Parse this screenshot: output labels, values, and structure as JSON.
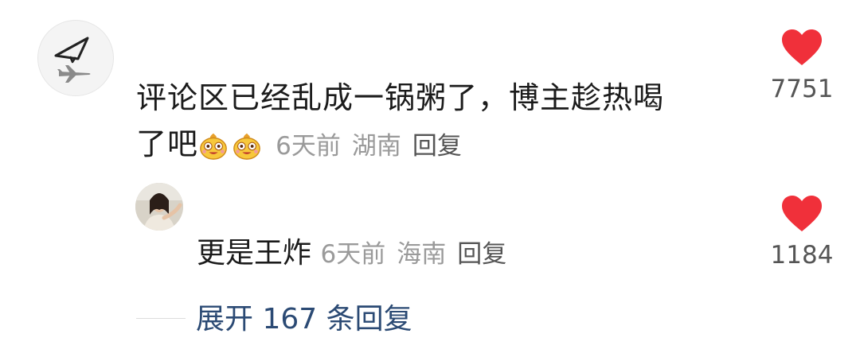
{
  "comment": {
    "text_line1": "评论区已经乱成一锅粥了，博主趁热喝",
    "text_line2": "了吧",
    "emojis": [
      "gold-coin-face-emoji",
      "gold-coin-face-emoji"
    ],
    "time": "6天前",
    "location": "湖南",
    "reply_label": "回复",
    "likes": "7751"
  },
  "reply": {
    "text": "更是王炸",
    "time": "6天前",
    "location": "海南",
    "reply_label": "回复",
    "likes": "1184"
  },
  "expand_replies": "展开 167 条回复",
  "colors": {
    "heart": "#f0303a",
    "link": "#2b4a74",
    "meta": "#9a9a9a",
    "text": "#1b1b1b"
  }
}
